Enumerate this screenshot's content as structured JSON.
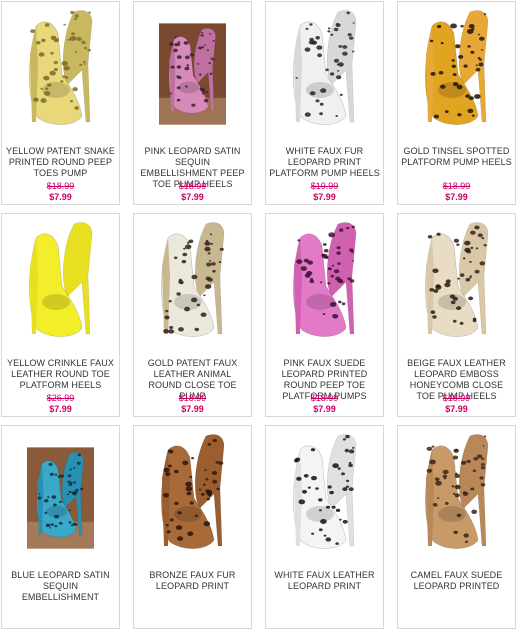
{
  "accent_color": "#cc0066",
  "products": [
    {
      "title": "YELLOW PATENT SNAKE PRINTED ROUND PEEP TOES PUMP",
      "old_price": "$18.99",
      "price": "$7.99",
      "image": "yellow-snake-pump",
      "photo_bg": false,
      "colors": {
        "body": "#e8d87a",
        "spot": "#7a6a2a",
        "heel": "#c8b860"
      }
    },
    {
      "title": "PINK LEOPARD SATIN SEQUIN EMBELLISHMENT PEEP TOE PUMP HEELS",
      "old_price": "$18.99",
      "price": "$7.99",
      "image": "pink-leopard-sequin-pump",
      "photo_bg": true,
      "colors": {
        "body": "#d88ab8",
        "spot": "#3a2030",
        "heel": "#c070a0",
        "bg": "#7a4a30"
      }
    },
    {
      "title": "WHITE FAUX FUR LEOPARD PRINT PLATFORM PUMP HEELS",
      "old_price": "$19.99",
      "price": "$7.99",
      "image": "white-leopard-pump",
      "photo_bg": false,
      "colors": {
        "body": "#f0f0f0",
        "spot": "#222222",
        "heel": "#d8d8d8"
      }
    },
    {
      "title": "GOLD TINSEL SPOTTED PLATFORM PUMP HEELS",
      "old_price": "$18.99",
      "price": "$7.99",
      "image": "gold-spotted-pump",
      "photo_bg": false,
      "colors": {
        "body": "#e0a420",
        "spot": "#1a1208",
        "heel": "#e8a838"
      }
    },
    {
      "title": "YELLOW CRINKLE FAUX LEATHER ROUND TOE PLATFORM HEELS",
      "old_price": "$26.99",
      "price": "$7.99",
      "image": "yellow-crinkle-pump",
      "photo_bg": false,
      "colors": {
        "body": "#f2ee2a",
        "spot": "#f2ee2a",
        "heel": "#e6e020"
      }
    },
    {
      "title": "GOLD PATENT FAUX LEATHER ANIMAL ROUND CLOSE TOE PUMP",
      "old_price": "$18.99",
      "price": "$7.99",
      "image": "gold-animal-pump",
      "photo_bg": false,
      "colors": {
        "body": "#ece8dc",
        "spot": "#2a2218",
        "heel": "#c8b890"
      }
    },
    {
      "title": "PINK FAUX SUEDE LEOPARD PRINTED ROUND PEEP TOE PLATFORM PUMPS",
      "old_price": "$18.99",
      "price": "$7.99",
      "image": "pink-suede-leopard-pump",
      "photo_bg": false,
      "colors": {
        "body": "#e27ac8",
        "spot": "#3a1030",
        "heel": "#d060b0"
      }
    },
    {
      "title": "BEIGE FAUX LEATHER LEOPARD EMBOSS HONEYCOMB CLOSE TOE PUMP HEELS",
      "old_price": "$18.99",
      "price": "$7.99",
      "image": "beige-leopard-pump",
      "photo_bg": false,
      "colors": {
        "body": "#e8dcc4",
        "spot": "#2a1a10",
        "heel": "#d8c8a8"
      }
    },
    {
      "title": "BLUE LEOPARD SATIN SEQUIN EMBELLISHMENT",
      "old_price": "",
      "price": "",
      "image": "blue-leopard-sequin-pump",
      "photo_bg": true,
      "colors": {
        "body": "#3aa8c8",
        "spot": "#0a2a3a",
        "heel": "#2890b0",
        "bg": "#8a5a3a"
      }
    },
    {
      "title": "BRONZE FAUX FUR LEOPARD PRINT",
      "old_price": "",
      "price": "",
      "image": "bronze-leopard-pump",
      "photo_bg": false,
      "colors": {
        "body": "#a86a38",
        "spot": "#2a1608",
        "heel": "#9a5e30"
      }
    },
    {
      "title": "WHITE FAUX LEATHER LEOPARD PRINT",
      "old_price": "",
      "price": "",
      "image": "white-leather-leopard-pump",
      "photo_bg": false,
      "colors": {
        "body": "#f4f4f4",
        "spot": "#111111",
        "heel": "#e0e0e0"
      }
    },
    {
      "title": "CAMEL FAUX SUEDE LEOPARD PRINTED",
      "old_price": "",
      "price": "",
      "image": "camel-leopard-pump",
      "photo_bg": false,
      "colors": {
        "body": "#c89a68",
        "spot": "#3a2414",
        "heel": "#b88858"
      }
    }
  ]
}
